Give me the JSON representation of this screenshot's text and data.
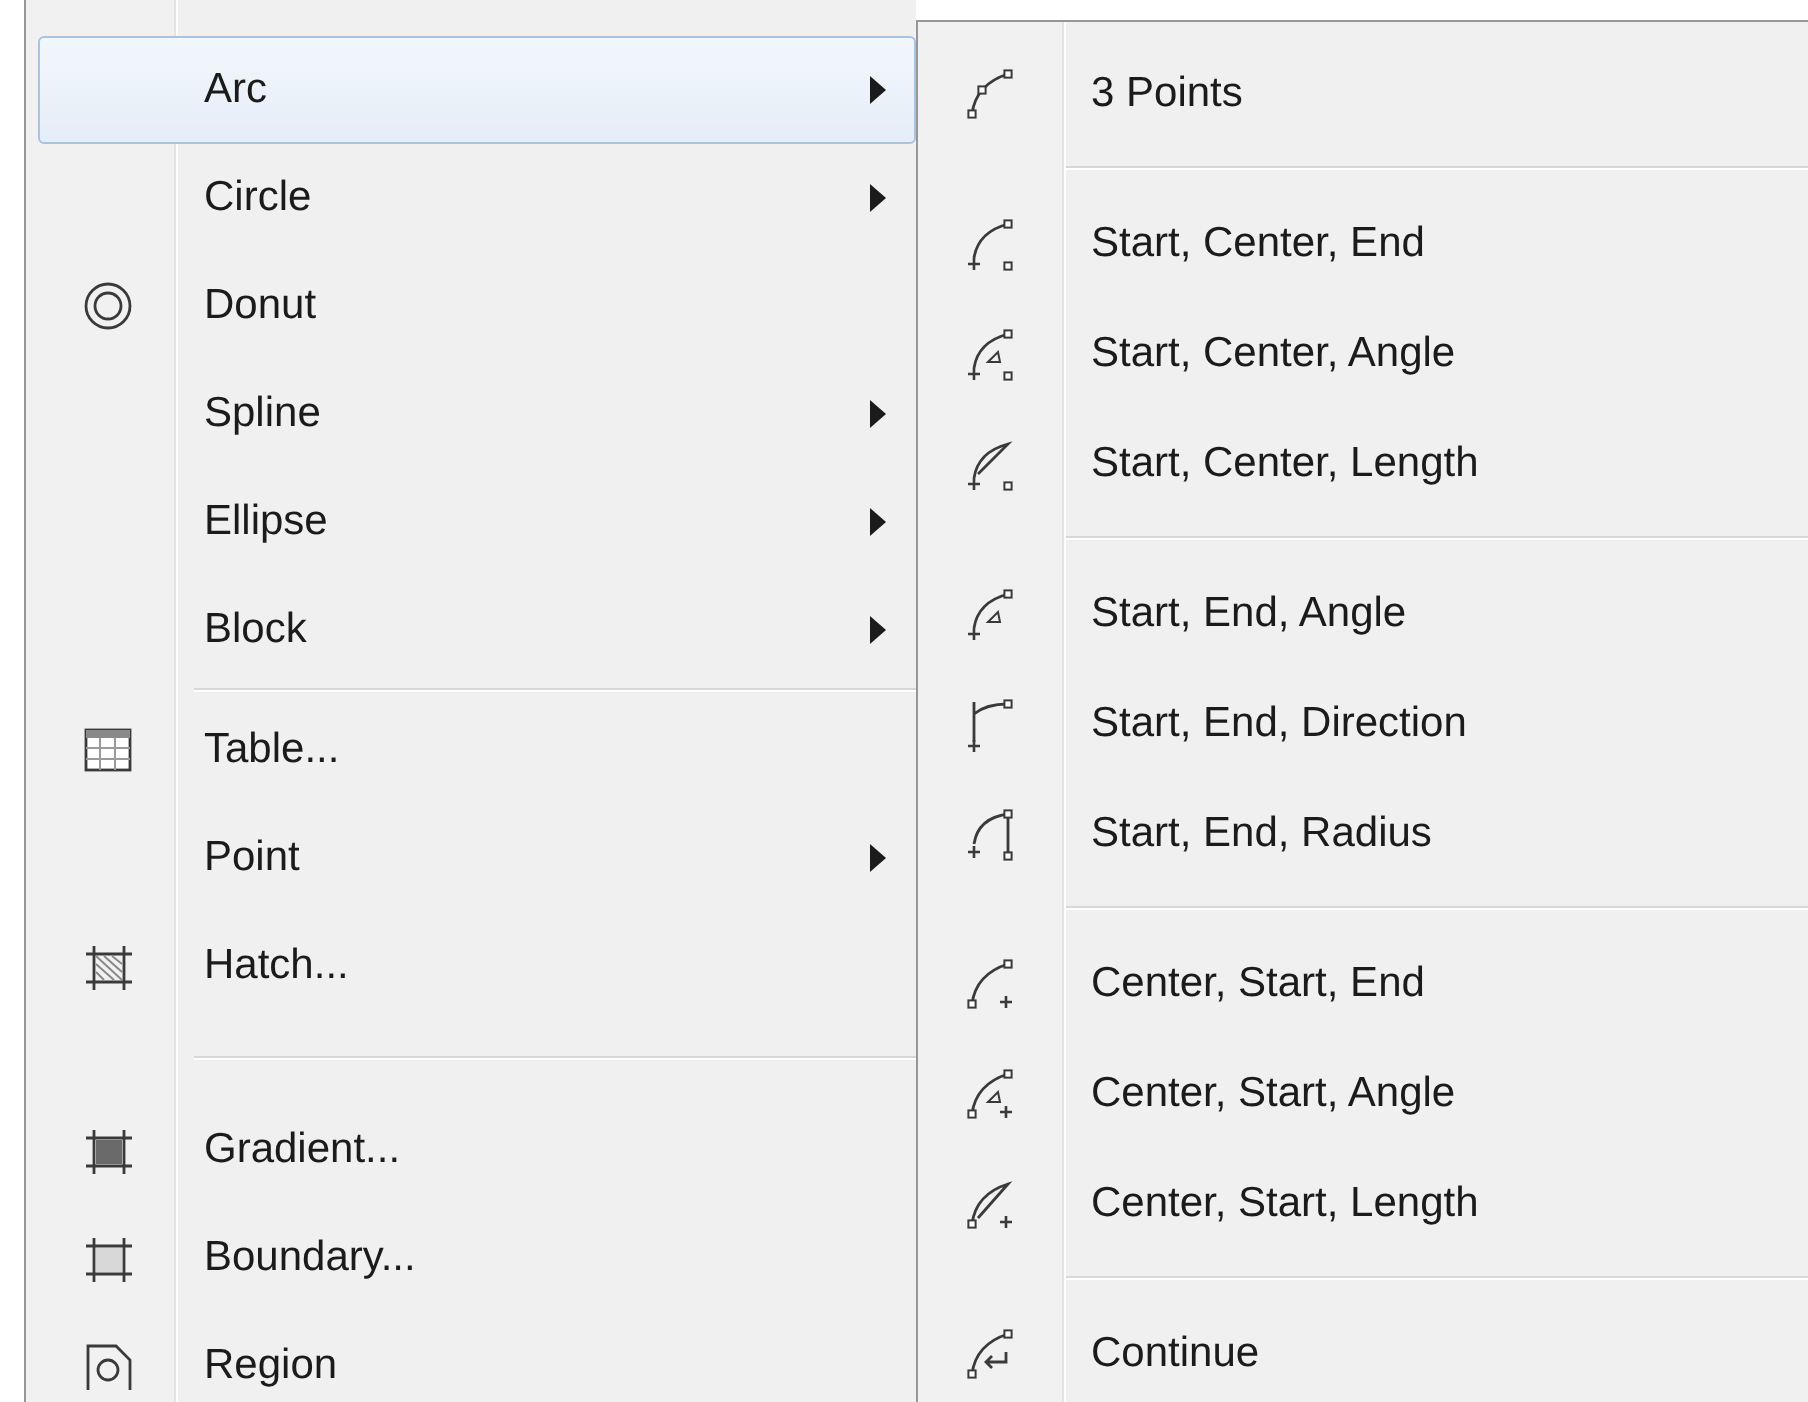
{
  "menu": {
    "groups": [
      [
        {
          "label": "Arc",
          "has_submenu": true,
          "selected": true
        },
        {
          "label": "Circle",
          "has_submenu": true,
          "selected": false
        },
        {
          "label": "Donut",
          "has_submenu": false,
          "selected": false
        },
        {
          "label": "Spline",
          "has_submenu": true,
          "selected": false
        },
        {
          "label": "Ellipse",
          "has_submenu": true,
          "selected": false
        },
        {
          "label": "Block",
          "has_submenu": true,
          "selected": false
        }
      ],
      [
        {
          "label": "Table...",
          "has_submenu": false,
          "selected": false
        },
        {
          "label": "Point",
          "has_submenu": true,
          "selected": false
        },
        {
          "label": "Hatch...",
          "has_submenu": false,
          "selected": false
        }
      ],
      [
        {
          "label": "Gradient...",
          "has_submenu": false,
          "selected": false
        },
        {
          "label": "Boundary...",
          "has_submenu": false,
          "selected": false
        },
        {
          "label": "Region",
          "has_submenu": false,
          "selected": false
        }
      ]
    ]
  },
  "submenu": {
    "groups": [
      [
        {
          "label": "3 Points"
        }
      ],
      [
        {
          "label": "Start, Center, End"
        },
        {
          "label": "Start, Center, Angle"
        },
        {
          "label": "Start, Center, Length"
        }
      ],
      [
        {
          "label": "Start, End, Angle"
        },
        {
          "label": "Start, End, Direction"
        },
        {
          "label": "Start, End, Radius"
        }
      ],
      [
        {
          "label": "Center, Start, End"
        },
        {
          "label": "Center, Start, Angle"
        },
        {
          "label": "Center, Start, Length"
        }
      ],
      [
        {
          "label": "Continue"
        }
      ]
    ]
  }
}
